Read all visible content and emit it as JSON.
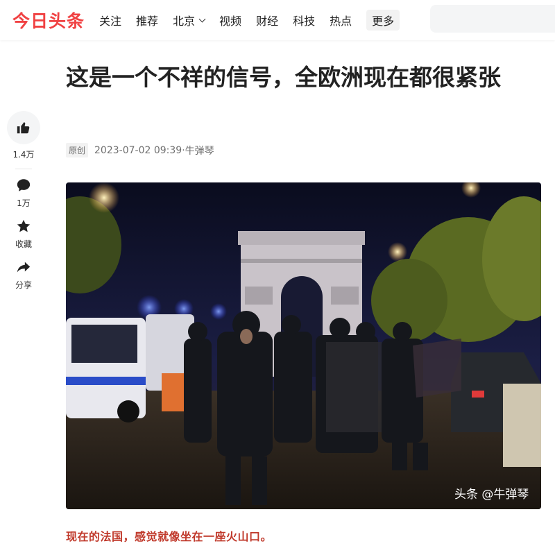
{
  "header": {
    "logo": "今日头条",
    "nav": [
      "关注",
      "推荐",
      "北京",
      "视频",
      "财经",
      "科技",
      "热点",
      "更多"
    ],
    "search_placeholder": ""
  },
  "rail": {
    "likes": "1.4万",
    "comments": "1万",
    "favorite_label": "收藏",
    "share_label": "分享"
  },
  "article": {
    "title": "这是一个不祥的信号，全欧洲现在都很紧张",
    "tag": "原创",
    "datetime": "2023-07-02 09:39",
    "separator": " · ",
    "author": "牛弹琴",
    "image_watermark": "头条 @牛弹琴",
    "first_paragraph": "现在的法国，感觉就像坐在一座火山口。"
  },
  "colors": {
    "brand": "#f04142",
    "caption": "#c0392b"
  },
  "icons": {
    "like": "thumbs-up-icon",
    "comment": "comment-bubble-icon",
    "favorite": "star-icon",
    "share": "share-arrow-icon"
  }
}
